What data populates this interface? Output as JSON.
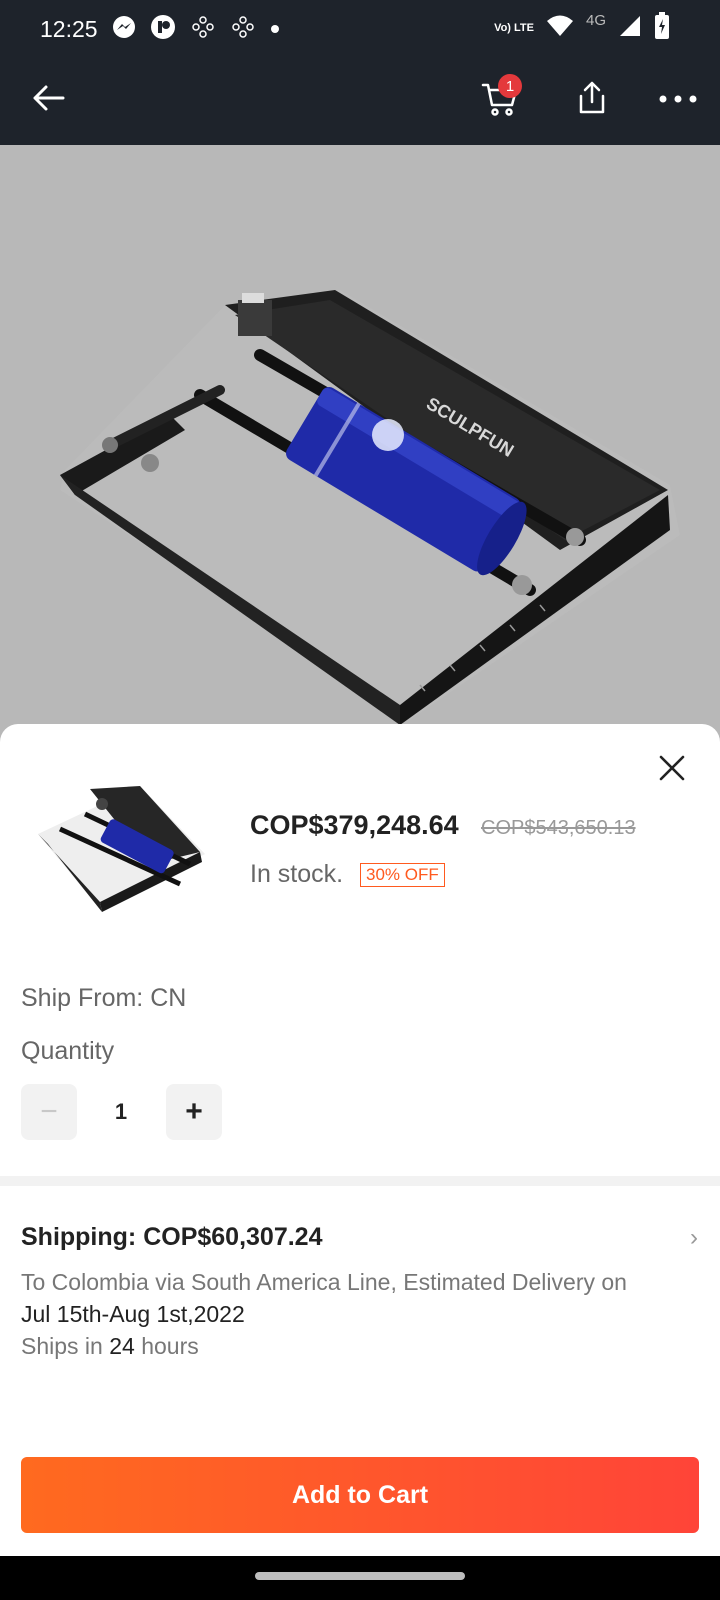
{
  "status_bar": {
    "time": "12:25",
    "network": "4G",
    "volte": "Vo) LTE",
    "left_icons": [
      "messenger-icon",
      "app-icon",
      "game-icon",
      "game-icon",
      "dot-icon"
    ],
    "right_icons": [
      "volte-icon",
      "wifi-icon",
      "signal-icon",
      "battery-icon"
    ]
  },
  "toolbar": {
    "cart_count": "1",
    "icons": [
      "back-arrow-icon",
      "cart-icon",
      "share-icon",
      "more-icon"
    ]
  },
  "hero": {
    "brand_print": "SCULPFUN"
  },
  "sheet": {
    "price": "COP$379,248.64",
    "original_price": "COP$543,650.13",
    "stock": "In stock.",
    "discount": "30% OFF",
    "ship_from": "Ship From: CN",
    "quantity_label": "Quantity",
    "quantity_value": "1",
    "minus_label": "−",
    "plus_label": "+",
    "shipping": {
      "title": "Shipping: COP$60,307.24",
      "desc_prefix": "To Colombia via South America Line, Estimated Delivery on ",
      "delivery_dates": "Jul 15th-Aug 1st,2022",
      "ships_prefix": "Ships in ",
      "ships_hours": "24",
      "ships_suffix": " hours"
    },
    "add_to_cart": "Add to Cart"
  },
  "colors": {
    "accent": "#ff5a1f",
    "badge": "#e4393c",
    "header_bg": "#1e232b"
  }
}
